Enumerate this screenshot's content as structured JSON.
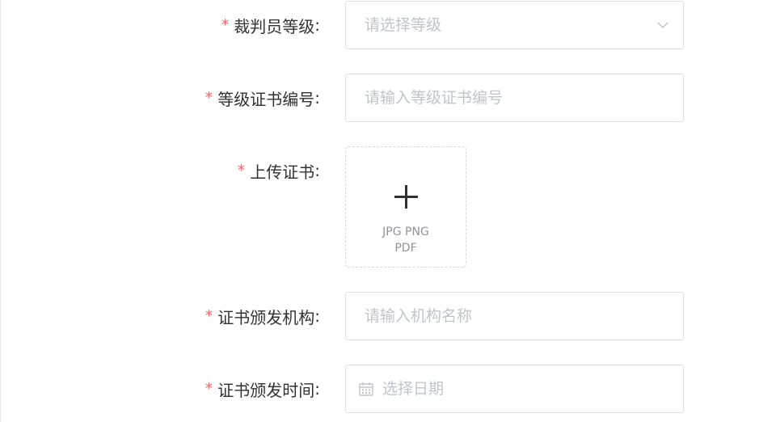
{
  "form": {
    "fields": [
      {
        "required_mark": "*",
        "label": "裁判员等级",
        "colon": ":",
        "placeholder": "请选择等级",
        "control": "select",
        "icon": "chevron-down-icon"
      },
      {
        "required_mark": "*",
        "label": "等级证书编号",
        "colon": ":",
        "placeholder": "请输入等级证书编号",
        "control": "text-input"
      },
      {
        "required_mark": "*",
        "label": "上传证书",
        "colon": ":",
        "control": "upload",
        "icon": "plus-icon",
        "hint_line1": "JPG PNG",
        "hint_line2": "PDF"
      },
      {
        "required_mark": "*",
        "label": "证书颁发机构",
        "colon": ":",
        "placeholder": "请输入机构名称",
        "control": "text-input"
      },
      {
        "required_mark": "*",
        "label": "证书颁发时间",
        "colon": ":",
        "placeholder": "选择日期",
        "control": "date-picker",
        "icon": "calendar-icon"
      }
    ]
  },
  "colors": {
    "required": "#f56c6c",
    "label_text": "#303133",
    "placeholder": "#c0c4cc",
    "border": "#dcdfe6",
    "upload_hint": "#909399"
  }
}
